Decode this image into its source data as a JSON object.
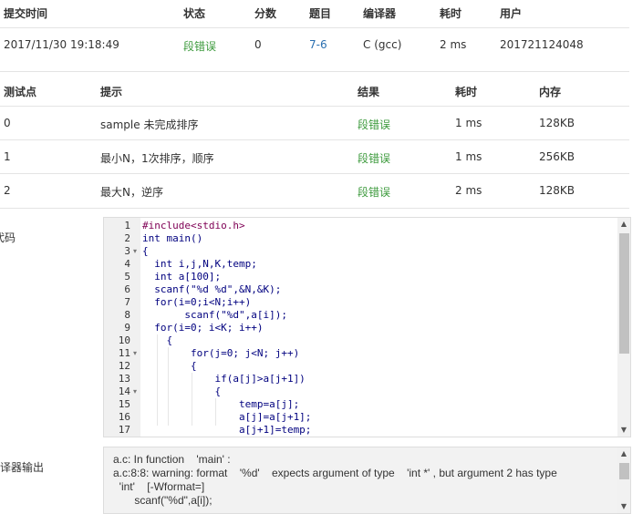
{
  "submission": {
    "headers": [
      "提交时间",
      "状态",
      "分数",
      "题目",
      "编译器",
      "耗时",
      "用户"
    ],
    "row": {
      "time": "2017/11/30 19:18:49",
      "status": "段错误",
      "score": "0",
      "problem": "7-6",
      "compiler": "C (gcc)",
      "elapsed": "2 ms",
      "user": "201721124048"
    }
  },
  "tests": {
    "headers": [
      "测试点",
      "提示",
      "结果",
      "耗时",
      "内存"
    ],
    "rows": [
      {
        "id": "0",
        "hint": "sample 未完成排序",
        "result": "段错误",
        "time": "1 ms",
        "memory": "128KB"
      },
      {
        "id": "1",
        "hint": "最小N，1次排序，顺序",
        "result": "段错误",
        "time": "1 ms",
        "memory": "256KB"
      },
      {
        "id": "2",
        "hint": "最大N，逆序",
        "result": "段错误",
        "time": "2 ms",
        "memory": "128KB"
      }
    ]
  },
  "code_label": "代码",
  "compiler_output_label": "编译器输出",
  "colors": {
    "status_error": "#3c9a3c",
    "problem_link": "#2a6fb0"
  },
  "code_lines": [
    {
      "n": "1",
      "fold": false
    },
    {
      "n": "2",
      "fold": false
    },
    {
      "n": "3",
      "fold": true
    },
    {
      "n": "4",
      "fold": false
    },
    {
      "n": "5",
      "fold": false
    },
    {
      "n": "6",
      "fold": false
    },
    {
      "n": "7",
      "fold": false
    },
    {
      "n": "8",
      "fold": false
    },
    {
      "n": "9",
      "fold": false
    },
    {
      "n": "10",
      "fold": false
    },
    {
      "n": "11",
      "fold": true
    },
    {
      "n": "12",
      "fold": false
    },
    {
      "n": "13",
      "fold": false
    },
    {
      "n": "14",
      "fold": true
    },
    {
      "n": "15",
      "fold": false
    },
    {
      "n": "16",
      "fold": false
    },
    {
      "n": "17",
      "fold": false
    }
  ],
  "code_text": [
    "#include<stdio.h>",
    "int main()",
    "{",
    "  int i,j,N,K,temp;",
    "  int a[100];",
    "  scanf(\"%d %d\",&N,&K);",
    "  for(i=0;i<N;i++)",
    "       scanf(\"%d\",a[i]);",
    "  for(i=0; i<K; i++)",
    "    {",
    "        for(j=0; j<N; j++)",
    "        {",
    "            if(a[j]>a[j+1])",
    "            {",
    "                temp=a[j];",
    "                a[j]=a[j+1];",
    "                a[j+1]=temp;"
  ],
  "compiler_output": [
    "a.c: In function    'main' :",
    "a.c:8:8: warning: format    '%d'    expects argument of type    'int *' , but argument 2 has type",
    "  'int'    [-Wformat=]",
    "       scanf(\"%d\",a[i]);"
  ]
}
